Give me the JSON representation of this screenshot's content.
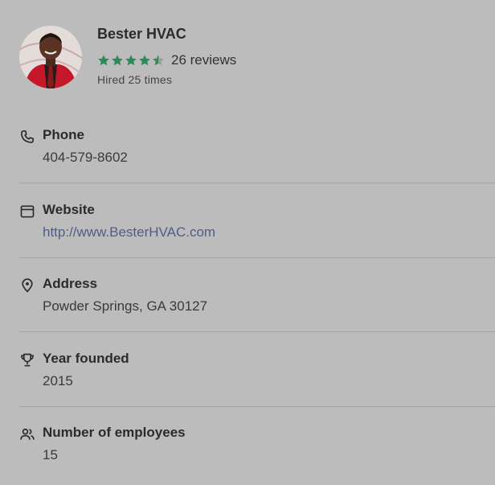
{
  "business": {
    "name": "Bester HVAC",
    "rating": 4.5,
    "reviews_label": "26 reviews",
    "hired_label": "Hired 25 times"
  },
  "details": {
    "phone": {
      "title": "Phone",
      "value": "404-579-8602",
      "icon": "phone-icon"
    },
    "website": {
      "title": "Website",
      "value": "http://www.BesterHVAC.com",
      "icon": "browser-window-icon"
    },
    "address": {
      "title": "Address",
      "value": "Powder Springs, GA 30127",
      "icon": "location-pin-icon"
    },
    "year_founded": {
      "title": "Year founded",
      "value": "2015",
      "icon": "trophy-icon"
    },
    "employees": {
      "title": "Number of employees",
      "value": "15",
      "icon": "people-icon"
    }
  },
  "colors": {
    "background": "#bcbcbc",
    "star": "#2e8b57",
    "link": "#4f5d8a",
    "divider": "#a5a5a5"
  }
}
